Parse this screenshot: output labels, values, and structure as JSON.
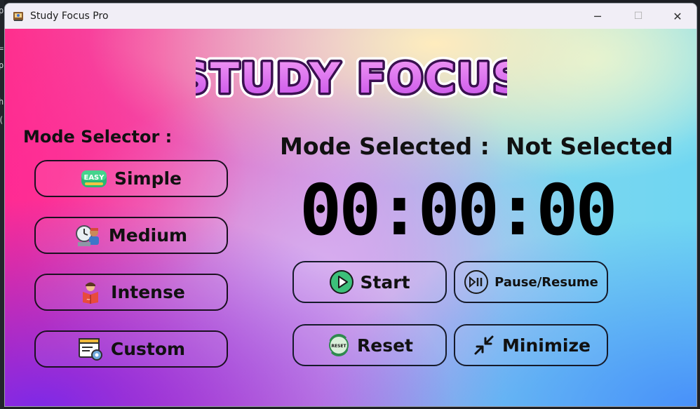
{
  "window": {
    "title": "Study Focus Pro"
  },
  "controls": {
    "minimize": "─",
    "maximize": "☐",
    "close": "✕"
  },
  "background_strip": [
    "p",
    "=",
    "p",
    "h",
    "("
  ],
  "logo_text": "STUDY FOCUS",
  "mode_selector": {
    "label": "Mode Selector :",
    "modes": [
      {
        "label": "Simple",
        "icon": "easy-badge-icon"
      },
      {
        "label": "Medium",
        "icon": "clock-worker-icon"
      },
      {
        "label": "Intense",
        "icon": "reading-student-icon"
      },
      {
        "label": "Custom",
        "icon": "settings-window-icon"
      }
    ]
  },
  "status": {
    "label": "Mode Selected :",
    "value": "Not Selected"
  },
  "timer": "00:00:00",
  "actions": {
    "start": "Start",
    "pause_resume": "Pause/Resume",
    "reset": "Reset",
    "minimize": "Minimize"
  },
  "colors": {
    "logo_fill": "#d86cf0",
    "start_icon": "#3cc07a",
    "logo_outline": "#3a1050"
  }
}
